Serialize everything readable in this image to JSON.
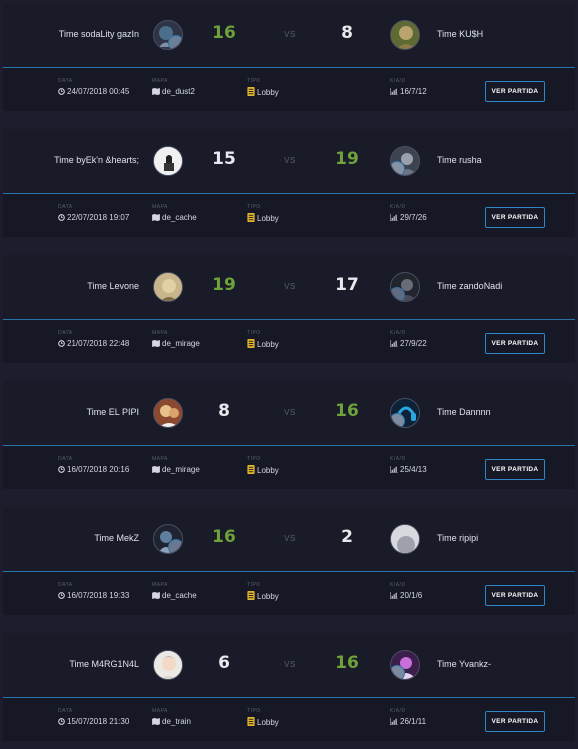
{
  "labels": {
    "vs": "VS",
    "date": "DATA",
    "map": "MAPA",
    "type": "TIPO",
    "kad": "K/A/D",
    "button": "VER PARTIDA"
  },
  "colors": {
    "win": "#6fa23a",
    "lose": "#e7e9ef",
    "accent": "#2a74a9"
  },
  "icons": {
    "date": "clock-icon",
    "map": "map-icon",
    "type": "lobby-icon",
    "kad": "bar-chart-icon"
  },
  "matches": [
    {
      "left_team": "Time sodaLity gazIn",
      "left_score": "16",
      "left_result": "win",
      "right_team": "Time KU$H",
      "right_score": "8",
      "right_result": "lose",
      "date": "24/07/2018 00:45",
      "map": "de_dust2",
      "type": "Lobby",
      "kad": "16/7/12"
    },
    {
      "left_team": "Time byEk'n &hearts;",
      "left_score": "15",
      "left_result": "lose",
      "right_team": "Time rusha",
      "right_score": "19",
      "right_result": "win",
      "date": "22/07/2018 19:07",
      "map": "de_cache",
      "type": "Lobby",
      "kad": "29/7/26"
    },
    {
      "left_team": "Time Levone",
      "left_score": "19",
      "left_result": "win",
      "right_team": "Time zandoNadi",
      "right_score": "17",
      "right_result": "lose",
      "date": "21/07/2018 22:48",
      "map": "de_mirage",
      "type": "Lobby",
      "kad": "27/9/22"
    },
    {
      "left_team": "Time EL PIPI",
      "left_score": "8",
      "left_result": "lose",
      "right_team": "Time Dannnn",
      "right_score": "16",
      "right_result": "win",
      "date": "16/07/2018 20:16",
      "map": "de_mirage",
      "type": "Lobby",
      "kad": "25/4/13"
    },
    {
      "left_team": "Time MekZ",
      "left_score": "16",
      "left_result": "win",
      "right_team": "Time ripipi",
      "right_score": "2",
      "right_result": "lose",
      "date": "16/07/2018 19:33",
      "map": "de_cache",
      "type": "Lobby",
      "kad": "20/1/6"
    },
    {
      "left_team": "Time M4RG1N4L",
      "left_score": "6",
      "left_result": "lose",
      "right_team": "Time Yvankz-",
      "right_score": "16",
      "right_result": "win",
      "date": "15/07/2018 21:30",
      "map": "de_train",
      "type": "Lobby",
      "kad": "26/1/11"
    }
  ]
}
